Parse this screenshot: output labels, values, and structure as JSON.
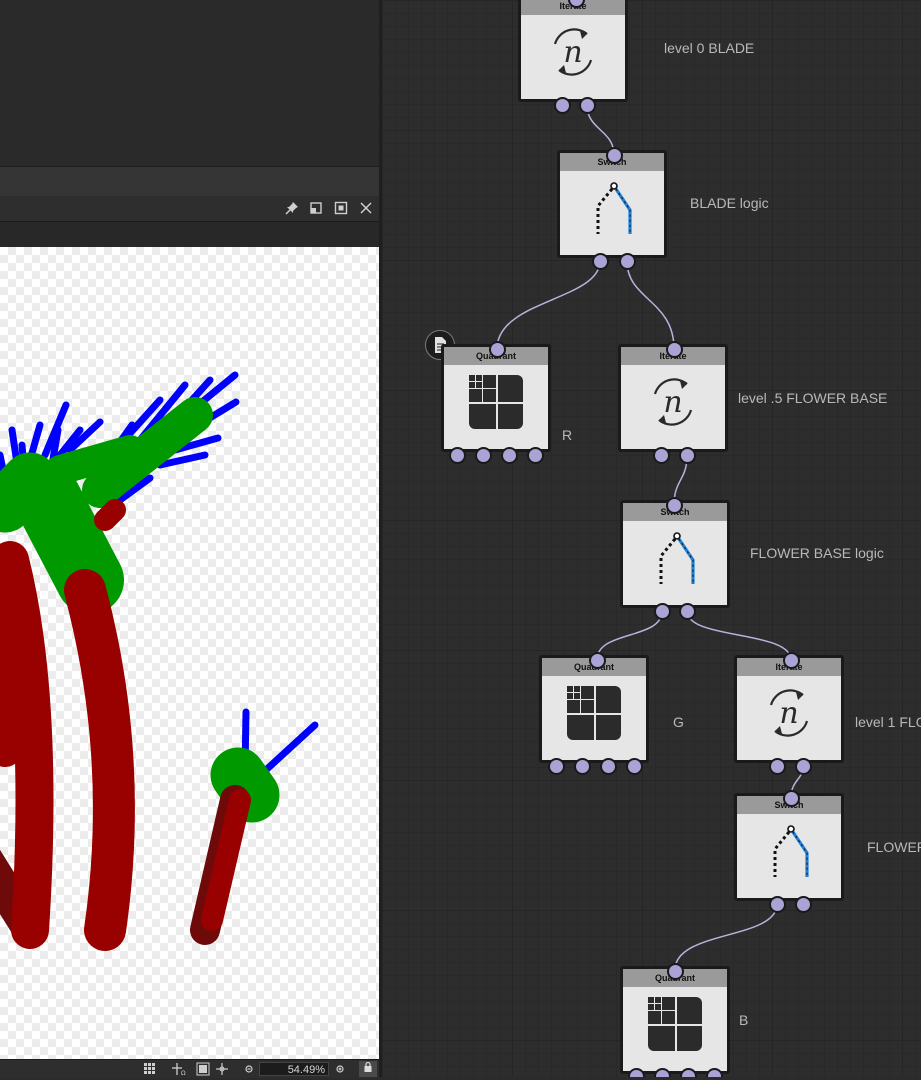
{
  "viewer": {
    "zoom_value": "54.49%",
    "header_icons": [
      "pin-icon",
      "float-window-icon",
      "maximize-icon",
      "close-icon"
    ],
    "status_icons": [
      "grid-icon",
      "transform-icon",
      "frame-icon",
      "pan-icon",
      "zoom-out-icon",
      "zoom-in-icon",
      "lock-icon"
    ]
  },
  "graph": {
    "nodes": [
      {
        "id": "iterate-top",
        "title": "Iterate",
        "label": "level 0 BLADE"
      },
      {
        "id": "switch-blade",
        "title": "Switch",
        "label": "BLADE logic"
      },
      {
        "id": "quadrant-r",
        "title": "Quadrant",
        "label": "R"
      },
      {
        "id": "iterate-flower-base",
        "title": "Iterate",
        "label": "level .5 FLOWER BASE"
      },
      {
        "id": "switch-flower-base",
        "title": "Switch",
        "label": "FLOWER BASE logic"
      },
      {
        "id": "quadrant-g",
        "title": "Quadrant",
        "label": "G"
      },
      {
        "id": "iterate-level1",
        "title": "Iterate",
        "label": "level 1 FLO"
      },
      {
        "id": "switch-flower",
        "title": "Switch",
        "label": "FLOWER"
      },
      {
        "id": "quadrant-b",
        "title": "Quadrant",
        "label": "B"
      }
    ]
  },
  "colors": {
    "port": "#a9a3d6",
    "wire": "#b8b3dc",
    "blade_red": "#990000",
    "leaf_green": "#009900",
    "spike_blue": "#0000ff",
    "switch_path": "#1f7fd6"
  }
}
